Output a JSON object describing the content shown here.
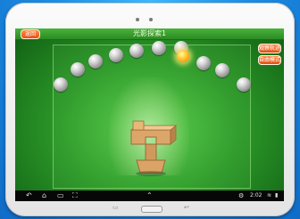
{
  "app": {
    "title": "光影探索1",
    "back_label": "返回",
    "right_buttons": [
      "观察轨迹",
      "自由模式"
    ]
  },
  "balls": {
    "count": 11,
    "lit_index": 6
  },
  "statusbar": {
    "time": "2:02"
  },
  "colors": {
    "accent_orange": "#e44f12",
    "app_green": "#2d9a2a",
    "sphere_lit": "#ffd23a",
    "tablet_body": "#f2f2f2",
    "background_blue": "#1e8fe6"
  },
  "icons": {
    "nav": [
      "back-icon",
      "home-icon",
      "recent-apps-icon",
      "screenshot-icon",
      "chevron-up-icon"
    ],
    "status": [
      "settings-icon",
      "wifi-icon",
      "battery-icon"
    ],
    "hardware": [
      "menu-icon",
      "home-key",
      "back-key"
    ]
  }
}
